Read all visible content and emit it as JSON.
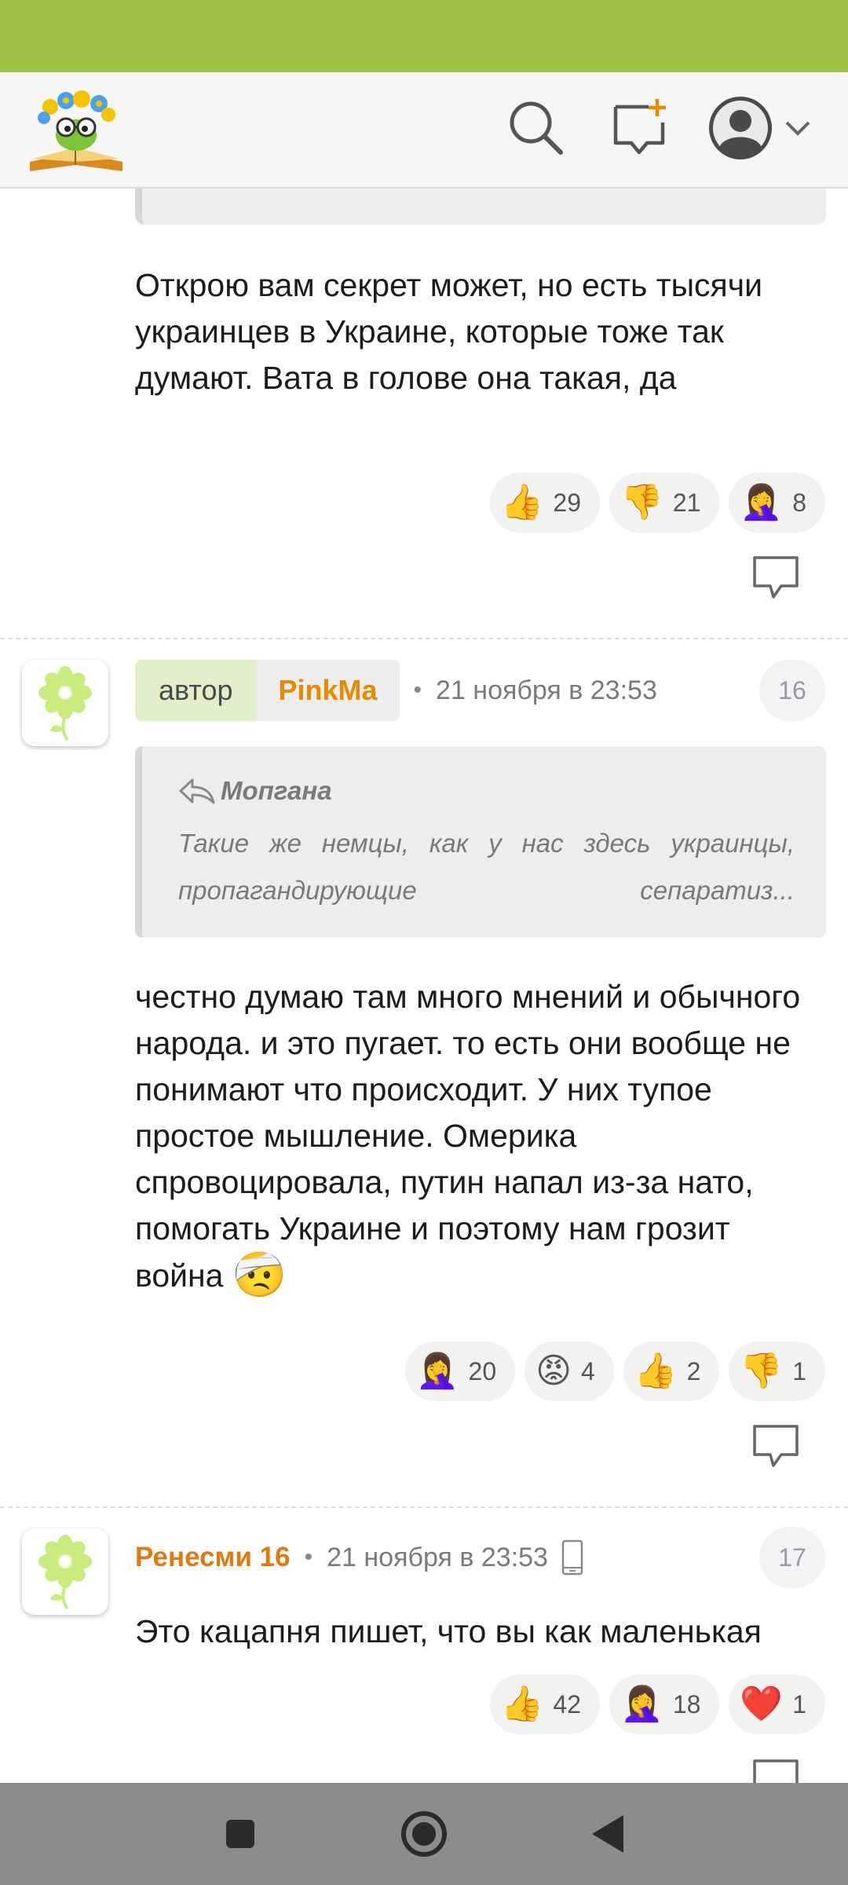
{
  "comments": [
    {
      "text": "Открою вам секрет может, но есть тысячи украинцев в Украине, которые тоже так думают. Вата в голове она такая, да",
      "reactions": [
        {
          "icon": "thumbs-up-icon",
          "emoji": "👍",
          "count": "29"
        },
        {
          "icon": "thumbs-down-icon",
          "emoji": "👎",
          "count": "21"
        },
        {
          "icon": "facepalm-icon",
          "emoji": "🤦‍♀️",
          "count": "8"
        }
      ]
    },
    {
      "author_badge": "автор",
      "username": "PinkMa",
      "timestamp": "21 ноября в 23:53",
      "number": "16",
      "quote": {
        "author": "Мопгана",
        "text": "Такие же немцы, как у нас здесь украинцы, пропагандирующие сепаратиз..."
      },
      "text": "честно думаю там много мнений и обычного народа. и это пугает. то есть они вообще не понимают что происходит. У них тупое простое мышление. Омерика спровоцировала, путин напал из-за нато, помогать Украине и поэтому нам грозит война",
      "text_emoji": "🤕",
      "reactions": [
        {
          "icon": "facepalm-icon",
          "emoji": "🤦‍♀️",
          "count": "20"
        },
        {
          "icon": "angry-face-icon",
          "emoji": "😡",
          "count": "4"
        },
        {
          "icon": "thumbs-up-icon",
          "emoji": "👍",
          "count": "2"
        },
        {
          "icon": "thumbs-down-icon",
          "emoji": "👎",
          "count": "1"
        }
      ]
    },
    {
      "username": "Ренесми 16",
      "timestamp": "21 ноября в 23:53",
      "number": "17",
      "text": "Это кацапня пишет, что вы как маленькая",
      "reactions": [
        {
          "icon": "thumbs-up-icon",
          "emoji": "👍",
          "count": "42"
        },
        {
          "icon": "facepalm-icon",
          "emoji": "🤦‍♀️",
          "count": "18"
        },
        {
          "icon": "heart-icon",
          "emoji": "❤️",
          "count": "1"
        }
      ]
    }
  ],
  "colors": {
    "status_bar": "#9dc247",
    "username": "#e07a10",
    "author_badge_bg": "#e1efcb",
    "nav_bar": "#8c8c8c"
  },
  "icons": {
    "header": [
      "app-logo-icon",
      "search-icon",
      "new-message-icon",
      "user-avatar-icon",
      "chevron-down-icon"
    ],
    "nav": [
      "recent-apps-icon",
      "home-icon",
      "back-icon"
    ]
  }
}
